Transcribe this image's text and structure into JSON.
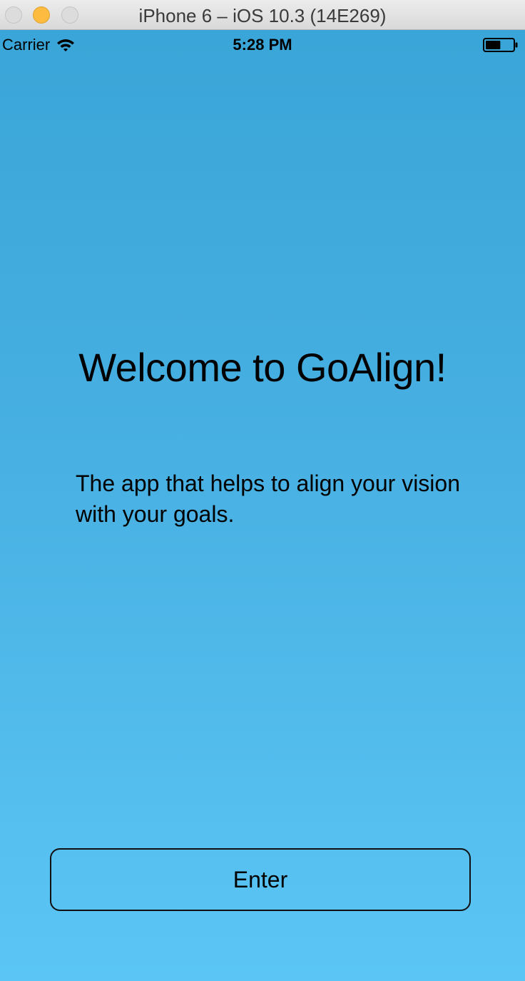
{
  "window": {
    "title": "iPhone 6 – iOS 10.3 (14E269)",
    "controls": [
      "close",
      "minimize",
      "zoom"
    ]
  },
  "status_bar": {
    "carrier": "Carrier",
    "time": "5:28 PM",
    "icons": [
      "wifi-icon",
      "battery-icon"
    ],
    "battery_level": 0.55
  },
  "content": {
    "title": "Welcome to GoAlign!",
    "subtitle": "The app that helps to align your vision with your goals.",
    "enter_button": "Enter"
  },
  "colors": {
    "background_top": "#3aa5d8",
    "background_bottom": "#5bc6f6",
    "minimize_button": "#fdbc40"
  }
}
